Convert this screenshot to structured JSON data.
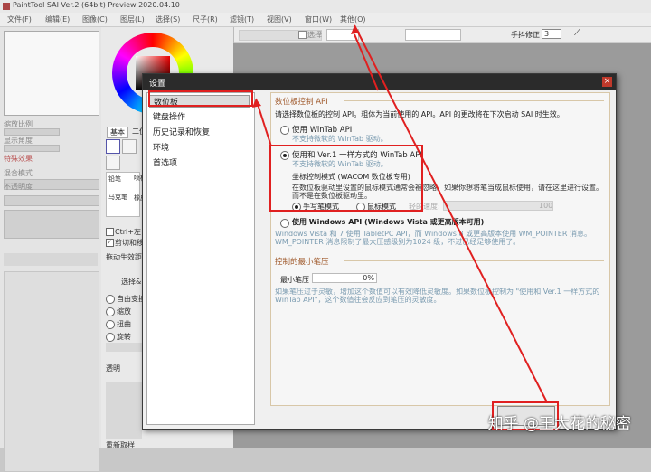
{
  "app": {
    "title": "PaintTool SAI Ver.2 (64bit) Preview 2020.04.10"
  },
  "menu": [
    "文件(F)",
    "编辑(E)",
    "图像(C)",
    "图层(L)",
    "选择(S)",
    "尺子(R)",
    "滤镜(T)",
    "视图(V)",
    "窗口(W)",
    "其他(O)"
  ],
  "toolbar": {
    "select_label": "选择",
    "stabilizer_label": "手抖修正",
    "stabilizer_value": "3"
  },
  "left": {
    "nav_labels": [
      "缩放比例",
      "显示角度"
    ],
    "brush_tabs": [
      "基本",
      "二值"
    ],
    "special_effects": "特殊效果",
    "mix_label": "混合模式",
    "opacity_label": "不透明度",
    "tools": [
      "铅笔",
      "喷枪",
      "马克笔",
      "橡皮"
    ],
    "checkboxes": [
      "Ctrl+左",
      "剪切和移"
    ],
    "drag_label": "拖动生效距离",
    "select_label": "选择&",
    "transform_options": [
      "自由变换",
      "缩放",
      "扭曲",
      "旋转"
    ],
    "transparency": "透明",
    "reset_label": "重新取样"
  },
  "dialog": {
    "title": "设置",
    "close_icon": "×",
    "categories": [
      "数位板",
      "键盘操作",
      "历史记录和恢复",
      "环境",
      "首选项"
    ],
    "selected_category": "数位板",
    "api_section": "数位板控制 API",
    "api_desc": "请选择数位板的控制 API。粗体为当前使用的 API。API 的更改将在下次启动 SAI 时生效。",
    "opt_wintab": "使用 WinTab API",
    "opt_wintab_note": "不支持微软的 WinTab 驱动。",
    "opt_ver1": "使用和 Ver.1 一样方式的 WinTab API",
    "opt_ver1_note": "不支持微软的 WinTab 驱动。",
    "coord_title": "坐标控制模式 (WACOM 数位板专用)",
    "coord_desc1": "在数位板驱动里设置的鼠标模式通常会被忽略。如果你想将笔当成鼠标使用，请在这里进行设置。",
    "coord_desc2": "而不是在数位板驱动里。",
    "pen_mode": "手写笔模式",
    "mouse_mode": "鼠标模式",
    "tablet_ratio": "轻的速度:",
    "tablet_ratio_value": "100",
    "opt_windows": "使用 Windows API (Windows Vista 或更高版本可用)",
    "windows_desc1": "Windows Vista 和 7 使用 TabletPC API，而 Windows 8 或更高版本使用 WM_POINTER 消息。",
    "windows_desc2": "WM_POINTER 消息限制了最大压感级别为1024 级，不过已经足够使用了。",
    "pressure_section": "控制的最小笔压",
    "min_pressure_label": "最小笔压",
    "min_pressure_value": "0%",
    "pressure_desc1": "如果笔压过于灵敏，增加这个数值可以有效降低灵敏度。如果数位板控制为 \"使用和 Ver.1 一样方式的",
    "pressure_desc2": "WinTab API\"，这个数值往会反应到笔压的灵敏度。"
  },
  "watermark": "知乎 @王大花的秘密",
  "colors": {
    "accent_red": "#e02020",
    "dialog_title": "#2b2b2b",
    "section_orange": "#a05a2c"
  }
}
